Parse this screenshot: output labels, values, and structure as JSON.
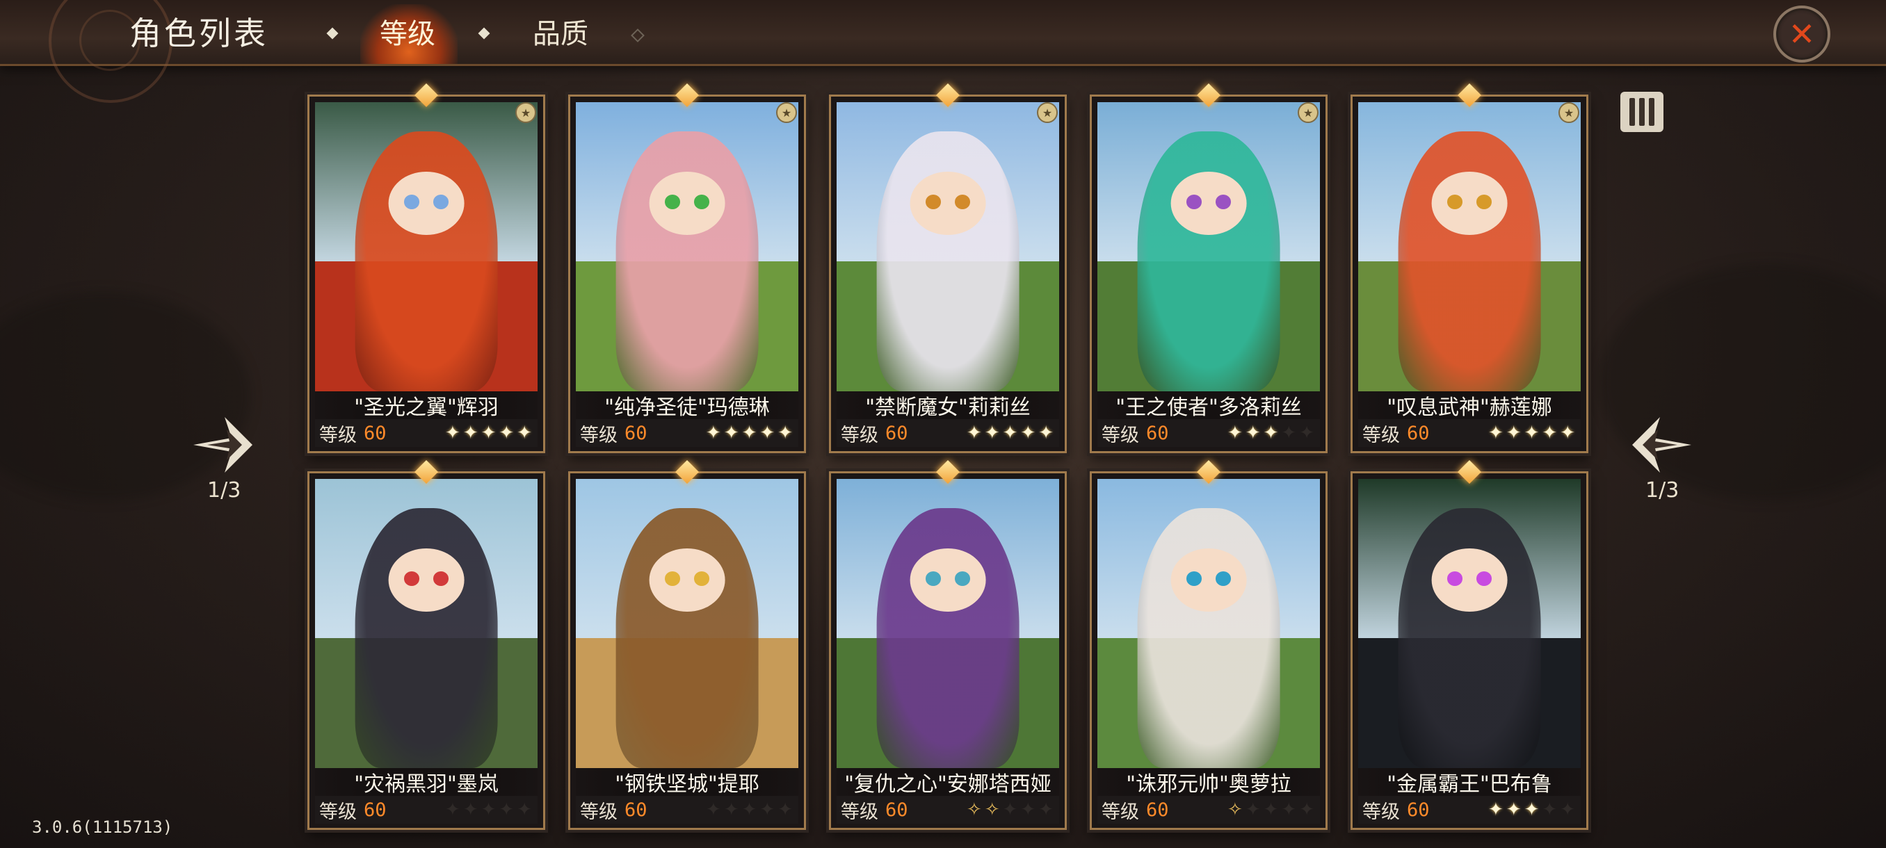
{
  "header": {
    "title": "角色列表",
    "tabs": [
      {
        "label": "等级",
        "active": true
      },
      {
        "label": "品质",
        "active": false
      }
    ]
  },
  "pagination": {
    "left_indicator": "1/3",
    "right_indicator": "1/3"
  },
  "level_label": "等级",
  "cards": [
    {
      "name": "\"圣光之翼\"辉羽",
      "level": "60",
      "stars": [
        "filled",
        "filled",
        "filled",
        "filled",
        "filled"
      ],
      "theme": {
        "sky": "#3a5a46",
        "ground": "#b8321c",
        "figure": "#d94a1e",
        "eye": "#7aa8e0"
      }
    },
    {
      "name": "\"纯净圣徒\"玛德琳",
      "level": "60",
      "stars": [
        "filled",
        "filled",
        "filled",
        "filled",
        "filled"
      ],
      "theme": {
        "sky": "#7fb0de",
        "ground": "#6e9a3e",
        "figure": "#e8a0a8",
        "eye": "#45b24a"
      }
    },
    {
      "name": "\"禁断魔女\"莉莉丝",
      "level": "60",
      "stars": [
        "filled",
        "filled",
        "filled",
        "filled",
        "filled"
      ],
      "theme": {
        "sky": "#8fb8e2",
        "ground": "#5c8a3a",
        "figure": "#e9e4ee",
        "eye": "#d28a2a"
      }
    },
    {
      "name": "\"王之使者\"多洛莉丝",
      "level": "60",
      "stars": [
        "filled",
        "filled",
        "filled",
        "empty",
        "empty"
      ],
      "theme": {
        "sky": "#7aaed6",
        "ground": "#527d36",
        "figure": "#2fb79a",
        "eye": "#9a52c2"
      }
    },
    {
      "name": "\"叹息武神\"赫莲娜",
      "level": "60",
      "stars": [
        "filled",
        "filled",
        "filled",
        "filled",
        "filled"
      ],
      "theme": {
        "sky": "#86b6dd",
        "ground": "#6a8d3c",
        "figure": "#e0532a",
        "eye": "#d79a2a"
      }
    },
    {
      "name": "\"灾祸黑羽\"墨岚",
      "level": "60",
      "stars": [
        "empty",
        "empty",
        "empty",
        "empty",
        "empty"
      ],
      "theme": {
        "sky": "#9cc3d6",
        "ground": "#4f6a3a",
        "figure": "#2d2a36",
        "eye": "#d23a3a"
      }
    },
    {
      "name": "\"钢铁坚城\"提耶",
      "level": "60",
      "stars": [
        "empty",
        "empty",
        "empty",
        "empty",
        "empty"
      ],
      "theme": {
        "sky": "#9ec6e4",
        "ground": "#c79b58",
        "figure": "#8a5a2a",
        "eye": "#e2b23a"
      }
    },
    {
      "name": "\"复仇之心\"安娜塔西娅",
      "level": "60",
      "stars": [
        "outline",
        "outline",
        "empty",
        "empty",
        "empty"
      ],
      "theme": {
        "sky": "#7eb0d8",
        "ground": "#4e7736",
        "figure": "#6b3a8c",
        "eye": "#4aa8c0"
      }
    },
    {
      "name": "\"诛邪元帅\"奥萝拉",
      "level": "60",
      "stars": [
        "outline",
        "empty",
        "empty",
        "empty",
        "empty"
      ],
      "theme": {
        "sky": "#8ab9e0",
        "ground": "#5c8a3e",
        "figure": "#e9e2dc",
        "eye": "#2fa0c8"
      }
    },
    {
      "name": "\"金属霸王\"巴布鲁",
      "level": "60",
      "stars": [
        "filled",
        "filled",
        "filled",
        "empty",
        "empty"
      ],
      "theme": {
        "sky": "#1f3a28",
        "ground": "#1a1d22",
        "figure": "#2a2a32",
        "eye": "#c84be0"
      }
    }
  ],
  "version": "3.0.6(1115713)"
}
